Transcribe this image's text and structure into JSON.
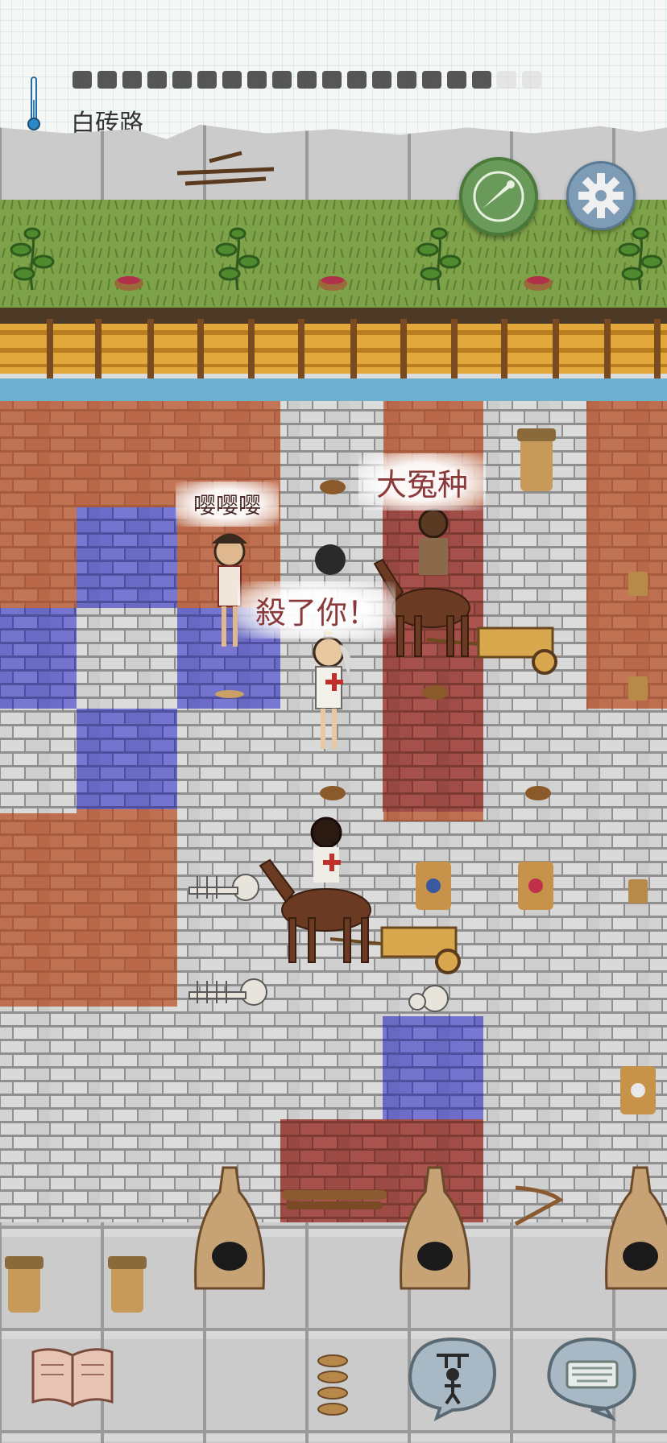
{
  "hud": {
    "location_label": "白砖路",
    "food_pips_total": 19,
    "food_pips_filled": 17
  },
  "speech": {
    "bubble_1": "嘤嘤嘤",
    "bubble_2": "大冤种",
    "bubble_3": "殺了你！"
  },
  "icons": {
    "temperature": "thermometer-icon",
    "compass": "compass-icon",
    "settings": "gear-icon",
    "tech_tree": "book-icon",
    "emote": "puppet-icon",
    "chat": "keyboard-icon"
  },
  "colors": {
    "grass": "#7fa24a",
    "red_brick": "#b86a4c",
    "blue_brick": "#6f6fc8",
    "white_brick": "#cfcfcf",
    "stone_floor": "#c8c8c8",
    "compass_green": "#6a9a5a",
    "gear_blue": "#6f8ea8"
  }
}
